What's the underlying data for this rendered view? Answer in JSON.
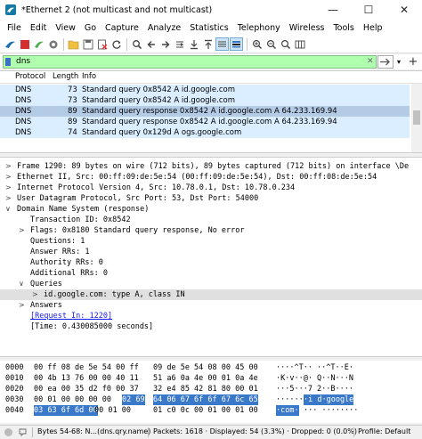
{
  "window": {
    "title": "*Ethernet 2 (not multicast and not multicast)",
    "minimize": "—",
    "maximize": "☐",
    "close": "✕"
  },
  "menu": [
    "File",
    "Edit",
    "View",
    "Go",
    "Capture",
    "Analyze",
    "Statistics",
    "Telephony",
    "Wireless",
    "Tools",
    "Help"
  ],
  "filter": {
    "value": "dns",
    "clear": "✕",
    "dropdown": "▾",
    "add": "+"
  },
  "packet_list": {
    "columns": [
      "Protocol",
      "Length",
      "Info"
    ],
    "rows": [
      {
        "protocol": "DNS",
        "length": "73",
        "info": "Standard query 0x8542 A id.google.com"
      },
      {
        "protocol": "DNS",
        "length": "73",
        "info": "Standard query 0x8542 A id.google.com"
      },
      {
        "protocol": "DNS",
        "length": "89",
        "info": "Standard query response 0x8542 A id.google.com A 64.233.169.94"
      },
      {
        "protocol": "DNS",
        "length": "89",
        "info": "Standard query response 0x8542 A id.google.com A 64.233.169.94"
      },
      {
        "protocol": "DNS",
        "length": "74",
        "info": "Standard query 0x129d A ogs.google.com"
      }
    ]
  },
  "details": [
    {
      "arrow": ">",
      "text": "Frame 1290: 89 bytes on wire (712 bits), 89 bytes captured (712 bits) on interface \\De"
    },
    {
      "arrow": ">",
      "text": "Ethernet II, Src: 00:ff:09:de:5e:54 (00:ff:09:de:5e:54), Dst: 00:ff:08:de:5e:54"
    },
    {
      "arrow": ">",
      "text": "Internet Protocol Version 4, Src: 10.78.0.1, Dst: 10.78.0.234"
    },
    {
      "arrow": ">",
      "text": "User Datagram Protocol, Src Port: 53, Dst Port: 54000"
    },
    {
      "arrow": "∨",
      "text": "Domain Name System (response)"
    },
    {
      "arrow": "",
      "text": "Transaction ID: 0x8542"
    },
    {
      "arrow": ">",
      "text": "Flags: 0x8180 Standard query response, No error"
    },
    {
      "arrow": "",
      "text": "Questions: 1"
    },
    {
      "arrow": "",
      "text": "Answer RRs: 1"
    },
    {
      "arrow": "",
      "text": "Authority RRs: 0"
    },
    {
      "arrow": "",
      "text": "Additional RRs: 0"
    },
    {
      "arrow": "∨",
      "text": "Queries"
    },
    {
      "arrow": ">",
      "text": "id.google.com: type A, class IN"
    },
    {
      "arrow": ">",
      "text": "Answers"
    },
    {
      "arrow": "",
      "text": "[Request In: 1220]"
    },
    {
      "arrow": "",
      "text": "[Time: 0.430085000 seconds]"
    }
  ],
  "bytes": [
    {
      "offset": "0000",
      "hex_a": "00 ff 08 de 5e 54 00 ff",
      "hex_b": "09 de 5e 54 08 00 45 00",
      "ascii": "····^T·· ··^T··E·"
    },
    {
      "offset": "0010",
      "hex_a": "00 4b 13 76 00 00 40 11",
      "hex_b": "51 a6 0a 4e 00 01 0a 4e",
      "ascii": "·K·v··@· Q··N···N"
    },
    {
      "offset": "0020",
      "hex_a": "00 ea 00 35 d2 f0 00 37",
      "hex_b": "32 e4 85 42 81 80 00 01",
      "ascii": "···5···7 2··B····"
    },
    {
      "offset": "0030",
      "hex_a": "00 01 00 00 00 00",
      "hex_a_hl": "02 69",
      "hex_b_hl": "64 06 67 6f 6f 67 6c 65",
      "ascii": "······",
      "ascii_hl": "·i d·google"
    },
    {
      "offset": "0040",
      "hex_a_hl": "03 63 6f 6d 00",
      "hex_a": " 00 01 00",
      "hex_b": "01 c0 0c 00 01 00 01 00",
      "ascii_hl": "·com·",
      "ascii": "··· ········"
    }
  ],
  "status": {
    "bytes_info": "Bytes 54-68: N...(dns.qry.name)",
    "packets": "Packets: 1618 · Displayed: 54 (3.3%) · Dropped: 0 (0.0%)",
    "profile": "Profile: Default"
  },
  "colors": {
    "row_dns": "#daeeff",
    "row_selected": "#b4cbe6",
    "filter_ok": "#afffaf",
    "bytes_highlight": "#3a78c9"
  },
  "toolbar_icons": [
    "fin-icon",
    "stop-icon",
    "restart-icon",
    "options-icon",
    "open-icon",
    "save-icon",
    "close-file-icon",
    "reload-icon",
    "find-icon",
    "go-back-icon",
    "go-forward-icon",
    "go-to-icon",
    "first-icon",
    "last-icon",
    "autoscroll-icon",
    "colorize-icon",
    "zoom-in-icon",
    "zoom-out-icon",
    "normal-size-icon",
    "resize-columns-icon"
  ]
}
